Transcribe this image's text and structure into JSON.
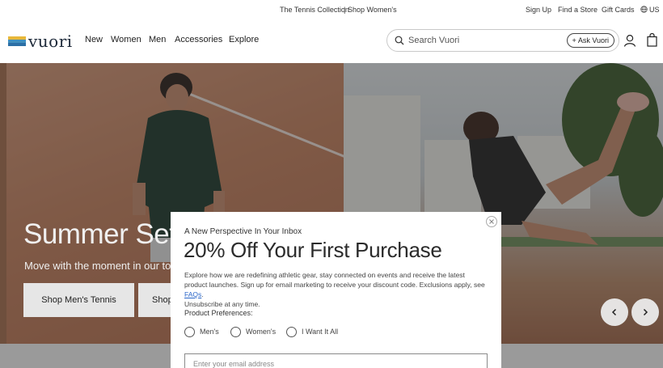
{
  "topbar": {
    "promo_left": "The Tennis Collection",
    "promo_separator": "|",
    "promo_right": "Shop Women's",
    "sign_up": "Sign Up",
    "find_store": "Find a Store",
    "gift_cards": "Gift Cards",
    "locale": "US"
  },
  "header": {
    "logo_text": "vuori",
    "nav": [
      "New",
      "Women",
      "Men",
      "Accessories",
      "Explore"
    ],
    "search_placeholder": "Search Vuori",
    "ask_button": "Ask Vuori",
    "icons": [
      "search-icon",
      "plus-icon",
      "account-icon",
      "bag-icon"
    ]
  },
  "hero": {
    "title": "Summer Set",
    "subtitle": "Move with the moment in our top-",
    "buttons": [
      "Shop Men's Tennis",
      "Shop"
    ],
    "prev_icon": "chevron-left-icon",
    "next_icon": "chevron-right-icon"
  },
  "modal": {
    "eyebrow": "A New Perspective In Your Inbox",
    "title": "20% Off Your First Purchase",
    "body": "Explore how we are redefining athletic gear, stay connected on events and receive the latest product launches. Sign up for email marketing to receive your discount code. Exclusions apply, see",
    "faq_link": "FAQs",
    "body_end": ".",
    "unsubscribe": "Unsubscribe at any time.",
    "preferences_label": "Product Preferences:",
    "options": [
      "Men's",
      "Women's",
      "I Want It All"
    ],
    "email_placeholder": "Enter your email address",
    "close_icon": "close-icon"
  },
  "colors": {
    "logo_stripes": [
      "#e8b83a",
      "#3f8fbf",
      "#2c6fa6"
    ],
    "overlay": "rgba(40,40,40,0.45)",
    "link": "#2a66c8"
  }
}
